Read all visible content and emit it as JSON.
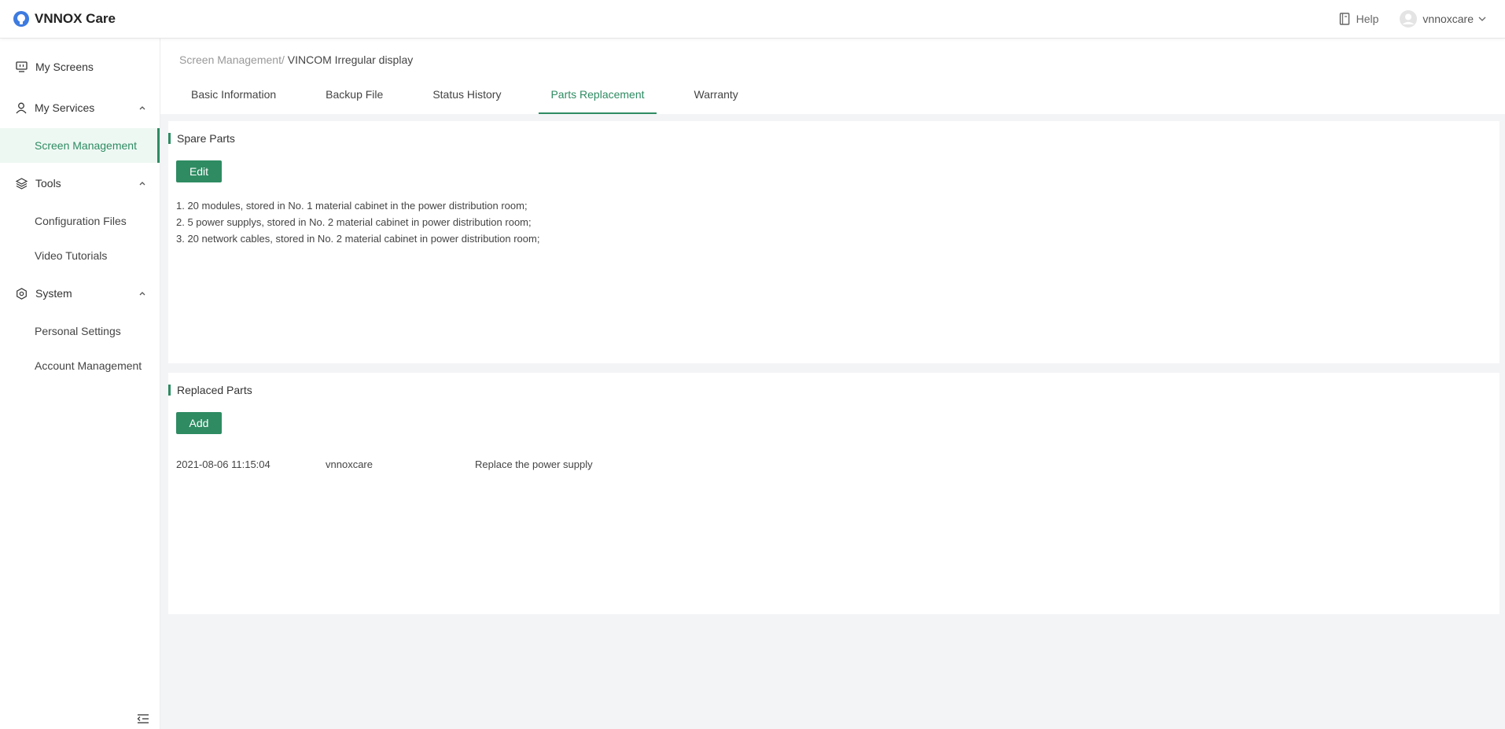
{
  "app": {
    "brand": "VNNOX Care"
  },
  "topbar": {
    "help": "Help",
    "username": "vnnoxcare"
  },
  "sidebar": {
    "groups": [
      {
        "label": "My Screens",
        "items": []
      },
      {
        "label": "My Services",
        "items": [
          {
            "label": "Screen Management",
            "active": true
          }
        ]
      },
      {
        "label": "Tools",
        "items": [
          {
            "label": "Configuration Files"
          },
          {
            "label": "Video Tutorials"
          }
        ]
      },
      {
        "label": "System",
        "items": [
          {
            "label": "Personal Settings"
          },
          {
            "label": "Account Management"
          }
        ]
      }
    ]
  },
  "breadcrumb": {
    "parent": "Screen Management/",
    "current": " VINCOM Irregular display"
  },
  "tabs": [
    {
      "label": "Basic Information"
    },
    {
      "label": "Backup File"
    },
    {
      "label": "Status History"
    },
    {
      "label": "Parts Replacement",
      "active": true
    },
    {
      "label": "Warranty"
    }
  ],
  "spare_parts": {
    "title": "Spare Parts",
    "edit_label": "Edit",
    "items": [
      "1. 20 modules, stored in No. 1 material cabinet in the power distribution room;",
      "2. 5 power supplys, stored in No. 2 material cabinet in power distribution room;",
      "3. 20 network cables, stored in No. 2 material cabinet in power distribution room;"
    ]
  },
  "replaced_parts": {
    "title": "Replaced Parts",
    "add_label": "Add",
    "records": [
      {
        "time": "2021-08-06 11:15:04",
        "user": "vnnoxcare",
        "description": "Replace the power supply"
      }
    ]
  },
  "colors": {
    "accent": "#2e8b62",
    "logo": "#3d7be0"
  },
  "icons": [
    "brand-logo-icon",
    "help-book-icon",
    "user-avatar-icon",
    "chevron-down-icon",
    "monitor-icon",
    "person-icon",
    "layers-icon",
    "gear-icon",
    "chevron-up-icon",
    "collapse-menu-icon"
  ]
}
